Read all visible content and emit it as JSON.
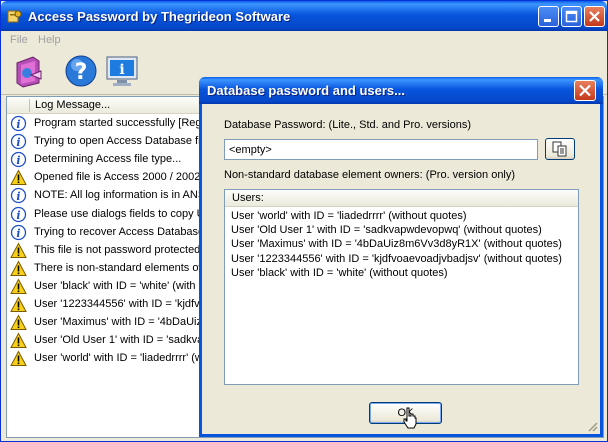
{
  "main_window": {
    "title": "Access Password by Thegrideon Software",
    "menu": {
      "file": "File",
      "help": "Help"
    }
  },
  "log": {
    "column_header": "Log Message...",
    "rows": [
      {
        "icon": "info",
        "text": "Program started successfully [Regi"
      },
      {
        "icon": "info",
        "text": "Trying to open Access Database fil"
      },
      {
        "icon": "info",
        "text": "Determining Access file type..."
      },
      {
        "icon": "warning",
        "text": "Opened file is Access 2000 / 2002("
      },
      {
        "icon": "info",
        "text": "NOTE: All log information is in ANSI"
      },
      {
        "icon": "info",
        "text": "Please use dialogs fields to copy U"
      },
      {
        "icon": "info",
        "text": "Trying to recover Access Database"
      },
      {
        "icon": "warning",
        "text": "This file is not password protected."
      },
      {
        "icon": "warning",
        "text": "There is non-standard elements ow"
      },
      {
        "icon": "warning",
        "text": "User 'black' with ID = 'white' (with"
      },
      {
        "icon": "warning",
        "text": "User '1223344556' with ID = 'kjdfv"
      },
      {
        "icon": "warning",
        "text": "User 'Maximus' with ID = '4bDaUiz"
      },
      {
        "icon": "warning",
        "text": "User 'Old User 1' with ID = 'sadkva"
      },
      {
        "icon": "warning",
        "text": "User 'world' with ID = 'liadedrrrr' (w"
      }
    ]
  },
  "dialog": {
    "title": "Database password and users...",
    "password_label": "Database Password: (Lite., Std. and Pro. versions)",
    "password_value": "<empty>",
    "owners_label": "Non-standard database element owners: (Pro. version only)",
    "users_header": "Users:",
    "users": [
      "User 'world' with ID = 'liadedrrrr' (without quotes)",
      "User 'Old User 1' with ID = 'sadkvapwdevopwq' (without quotes)",
      "User 'Maximus' with ID = '4bDaUiz8m6Vv3d8yR1X' (without quotes)",
      "User '1223344556' with ID = 'kjdfvoaevoadjvbadjsv' (without quotes)",
      "User 'black' with ID = 'white' (without quotes)"
    ],
    "ok_label": "OK"
  }
}
